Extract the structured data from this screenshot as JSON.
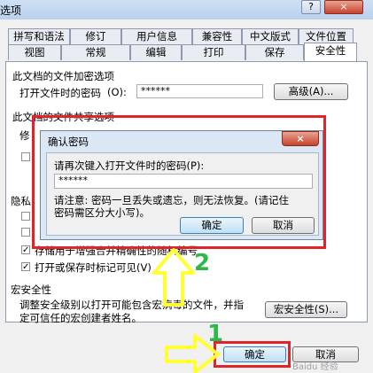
{
  "window": {
    "title": "选项",
    "help_button": "?",
    "close_button": "×"
  },
  "tabs_row1": [
    "拼写和语法",
    "修订",
    "用户信息",
    "兼容性",
    "中文版式",
    "文件位置"
  ],
  "tabs_row2": [
    "视图",
    "常规",
    "编辑",
    "打印",
    "保存",
    "安全性"
  ],
  "encryption": {
    "section_label": "此文档的文件加密选项",
    "password_label": "打开文件时的密码",
    "password_shortcut": "(O):",
    "password_value": "******",
    "advanced_button": "高级(A)..."
  },
  "sharing": {
    "section_label": "此文档的文件共享选项",
    "modify_label": "修"
  },
  "privacy": {
    "section_label": "隐私",
    "hidden_text_fragment": "存储用于增强合并精确性的随机编号",
    "marks_label": "打开或保存时标记可见(V)"
  },
  "macro": {
    "section_label": "宏安全性",
    "description_line1": "调整安全级别以打开可能包含宏病毒的文件，并指",
    "description_line2": "定可信任的宏创建者姓名。",
    "macro_button": "宏安全性(S)..."
  },
  "footer": {
    "ok_button": "确定",
    "cancel_button": "取消"
  },
  "confirm_dialog": {
    "title": "确认密码",
    "close_button": "×",
    "prompt": "请再次键入打开文件时的密码(P):",
    "password_value": "******",
    "notice_line1": "请注意: 密码一旦丢失或遗忘，则无法恢复。(请记住",
    "notice_line2": "密码需区分大小写)。",
    "ok_button": "确定",
    "cancel_button": "取消"
  },
  "annotations": {
    "step1": "1",
    "step2": "2",
    "color_red": "#e2232a",
    "color_green": "#2db84a",
    "color_yellow": "#ffff33"
  },
  "watermark": "Baidu 经验"
}
